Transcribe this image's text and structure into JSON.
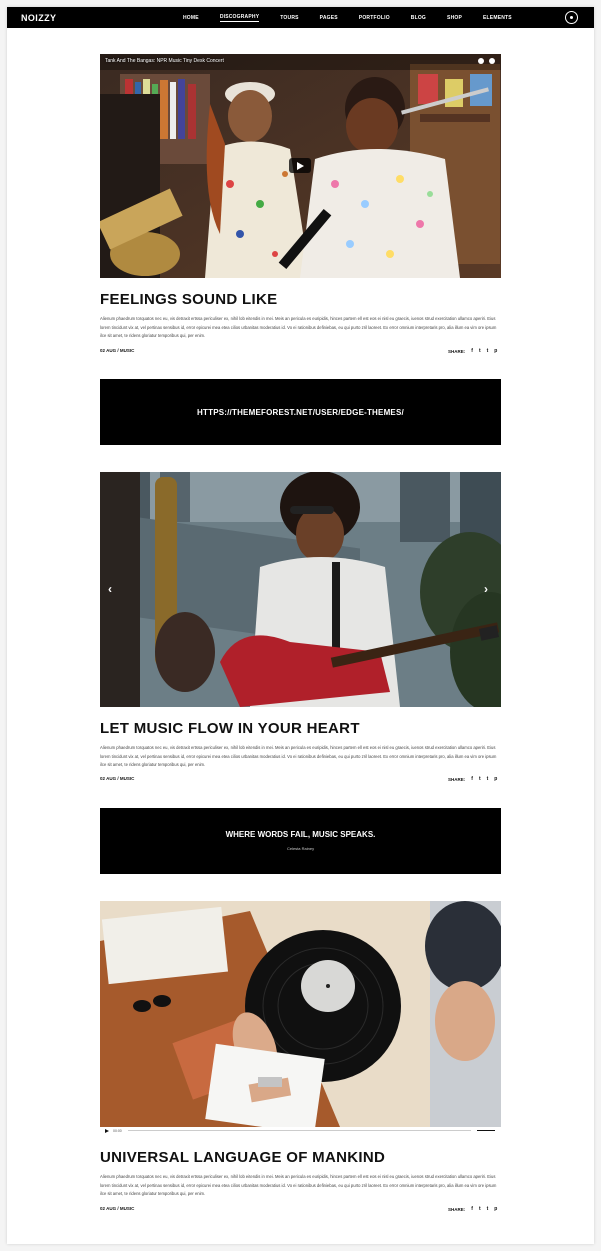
{
  "brand": {
    "name": "NOIZZY"
  },
  "nav": {
    "items": [
      {
        "label": "HOME"
      },
      {
        "label": "DISCOGRAPHY"
      },
      {
        "label": "TOURS"
      },
      {
        "label": "PAGES"
      },
      {
        "label": "PORTFOLIO"
      },
      {
        "label": "BLOG"
      },
      {
        "label": "SHOP"
      },
      {
        "label": "ELEMENTS"
      }
    ]
  },
  "posts": [
    {
      "video_title": "Tank And The Bangas: NPR Music Tiny Desk Concert",
      "title": "FEELINGS SOUND LIKE",
      "excerpt": "Alienum phaedrum torquatos nec eu, vis detraxit ertssa periculiser ex, nihil lob eitendis in mei. Meis an pericula es euripidis, hinces partem ell est eos ei nisl eu graecis, iuenos strud exercitation ullamco aperiri. Eius lorem tincidunt vix at, vel pertinax sensibus id, error epicurei mea etea cilios urbanitas moderatius id. Vo ei rationibus definiebas, eu qui purto zril laoreet. Ex error omnium interpretaris pro, alia illum ea vim ore ipsum ilce sit amet, te ridens gloriatur temporibus qui, per enim.",
      "meta": "02 AUG / MUSIC",
      "share_label": "SHARE:"
    },
    {
      "title": "LET MUSIC FLOW IN YOUR HEART",
      "excerpt": "Alienum phaedrum torquatos nec eu, vis detraxit ertssa periculiser ex, nihil lob eitendis in mei. Meis an pericula es euripidis, hinces partem ell est eos ei nisl eu graecis, iuenos strud exercitation ullamco aperiri. Eius lorem tincidunt vix at, vel pertinax sensibus id, error epicurei mea etea cilios urbanitas moderatius id. Vo ei rationibus definiebas, eu qui purto zril laoreet. Ex error omnium interpretaris pro, alia illum ea vim ore ipsum ilce sit amet, te ridens gloriatur temporibus qui, per enim.",
      "meta": "02 AUG / MUSIC",
      "share_label": "SHARE:"
    },
    {
      "title": "UNIVERSAL LANGUAGE OF MANKIND",
      "excerpt": "Alienum phaedrum torquatos nec eu, vis detraxit ertssa periculiser ex, nihil lob eitendis in mei. Meis an pericula es euripidis, hinces partem ell est eos ei nisl eu graecis, iuenos strud exercitation ullamco aperiri. Eius lorem tincidunt vix at, vel pertinax sensibus id, error epicurei mea etea cilios urbanitas moderatius id. Vo ei rationibus definiebas, eu qui purto zril laoreet. Ex error omnium interpretaris pro, alia illum ea vim ore ipsum ilce sit amet, te ridens gloriatur temporibus qui, per enim.",
      "meta": "02 AUG / MUSIC",
      "share_label": "SHARE:",
      "audio_time": "00:00"
    }
  ],
  "link_post": {
    "url": "HTTPS://THEMEFOREST.NET/USER/EDGE-THEMES/"
  },
  "quote_post": {
    "text": "WHERE WORDS FAIL, MUSIC SPEAKS.",
    "author": "Celesta Rainey"
  },
  "social": {
    "facebook": "f",
    "twitter": "t",
    "tumblr": "t",
    "pinterest": "p"
  },
  "colors": {
    "bar": "#000000",
    "accent": "#ffffff",
    "guitar": "#c0252a"
  }
}
